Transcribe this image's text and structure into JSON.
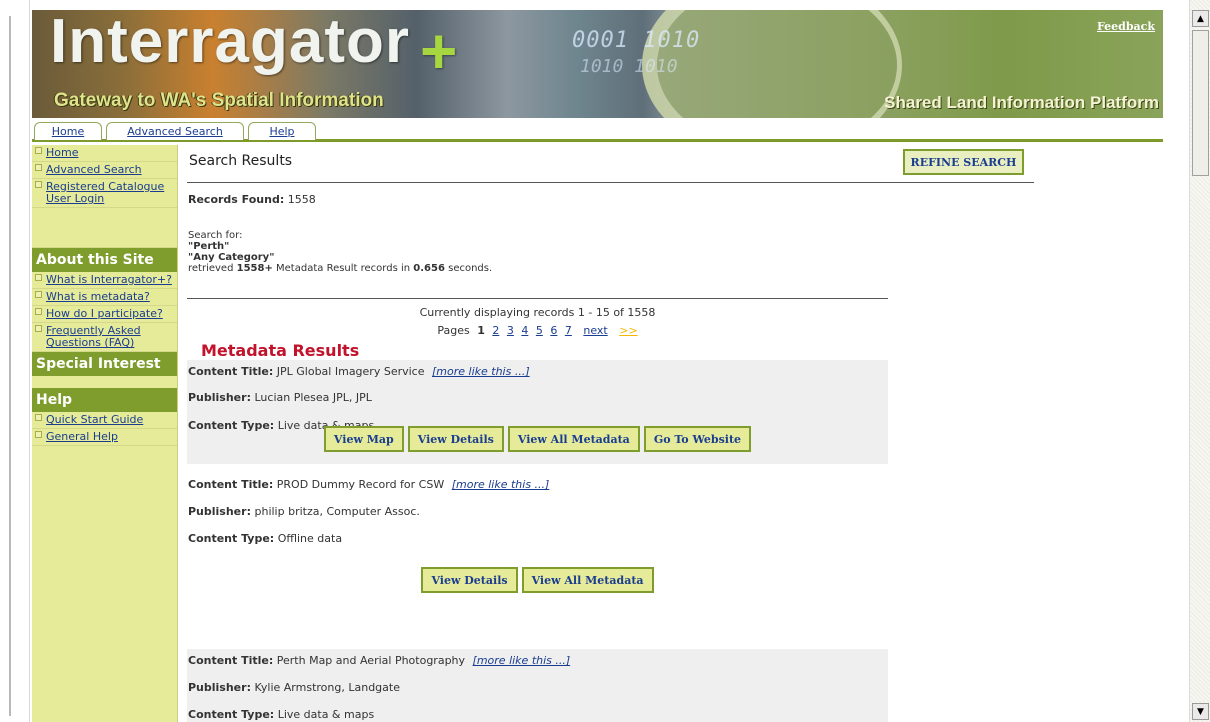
{
  "banner": {
    "brand": "Interragator",
    "plus": "+",
    "tagline": "Gateway to WA's Spatial Information",
    "platform": "Shared Land Information Platform",
    "feedback": "Feedback",
    "binary1": "0001 1010",
    "binary2": "1010 1010"
  },
  "tabs": [
    {
      "label": "Home"
    },
    {
      "label": "Advanced Search"
    },
    {
      "label": "Help"
    }
  ],
  "sidebar": {
    "top_items": [
      "Home",
      "Advanced Search",
      "Registered Catalogue User Login"
    ],
    "about_heading": "About this Site",
    "about_items": [
      "What is Interragator+?",
      "What is metadata?",
      "How do I participate?",
      "Frequently Asked Questions (FAQ)"
    ],
    "special_heading": "Special Interest",
    "help_heading": "Help",
    "help_items": [
      "Quick Start Guide",
      "General Help"
    ]
  },
  "main": {
    "title": "Search Results",
    "refine_label": "REFINE SEARCH",
    "records_label": "Records Found:",
    "records_value": "1558",
    "search_for_label": "Search for:",
    "query": "\"Perth\"",
    "category": "\"Any Category\"",
    "retrieved_prefix": "retrieved",
    "retrieved_count": "1558+",
    "retrieved_middle": "Metadata Result records in",
    "retrieved_time": "0.656",
    "retrieved_suffix": "seconds.",
    "displaying": "Currently displaying records 1 - 15 of 1558",
    "pages_label": "Pages",
    "current_page": "1",
    "pages": [
      "2",
      "3",
      "4",
      "5",
      "6",
      "7"
    ],
    "next": "next",
    "last": ">>",
    "metadata_heading": "Metadata Results"
  },
  "labels": {
    "content_title": "Content Title:",
    "publisher": "Publisher:",
    "content_type": "Content Type:",
    "more_like_this": "[more like this ...]"
  },
  "records": [
    {
      "title": "JPL Global Imagery Service",
      "publisher": "Lucian Plesea JPL, JPL",
      "type": "Live data & maps",
      "buttons": [
        "View Map",
        "View Details",
        "View All Metadata",
        "Go To Website"
      ]
    },
    {
      "title": "PROD Dummy Record for CSW",
      "publisher": "philip britza, Computer Assoc.",
      "type": "Offline data",
      "buttons": [
        "View Details",
        "View All Metadata"
      ]
    },
    {
      "title": "Perth Map and Aerial Photography",
      "publisher": "Kylie Armstrong, Landgate",
      "type": "Live data & maps",
      "buttons": []
    }
  ]
}
